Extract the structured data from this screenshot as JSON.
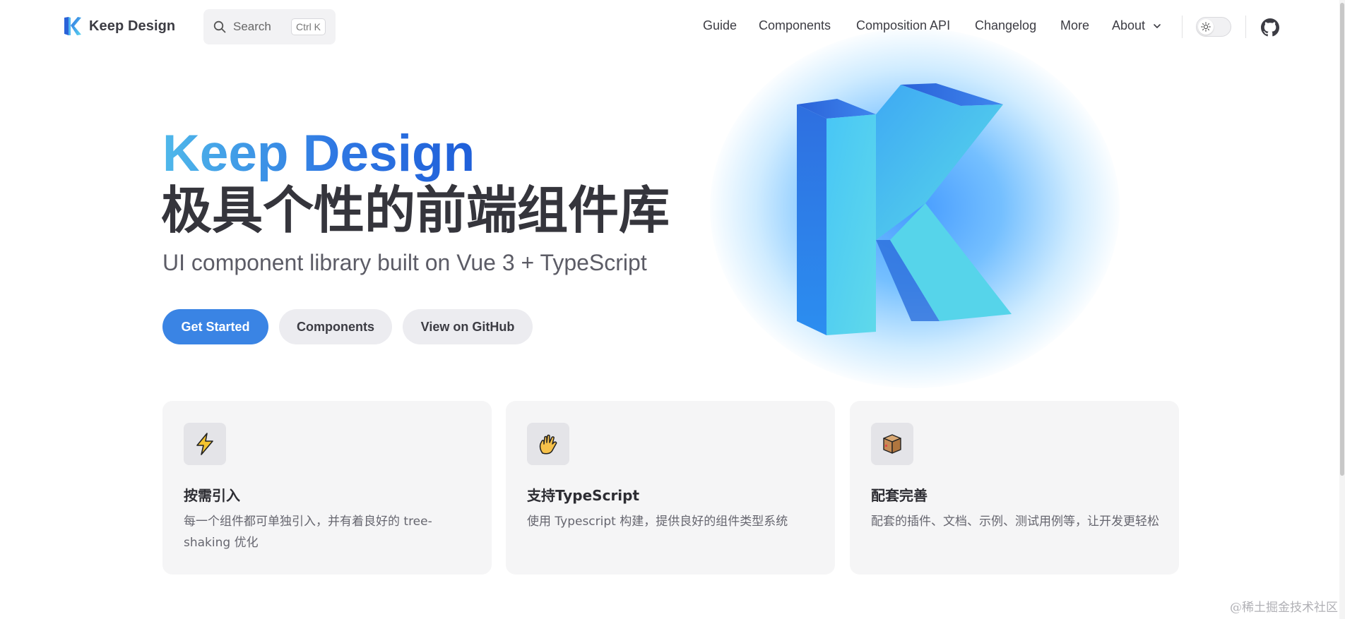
{
  "nav": {
    "brand": "Keep Design",
    "search": {
      "label": "Search",
      "shortcut": "Ctrl K"
    },
    "menu": [
      {
        "label": "Guide"
      },
      {
        "label": "Components"
      },
      {
        "label": "Composition API"
      },
      {
        "label": "Changelog"
      },
      {
        "label": "More"
      },
      {
        "label": "About"
      }
    ]
  },
  "hero": {
    "title": "Keep Design",
    "tagline": "极具个性的前端组件库",
    "subtitle": "UI component library built on Vue 3 + TypeScript",
    "buttons": {
      "primary": "Get Started",
      "components": "Components",
      "github": "View on GitHub"
    }
  },
  "features": [
    {
      "icon": "lightning-icon",
      "title": "按需引入",
      "desc": "每一个组件都可单独引入，并有着良好的 tree-shaking 优化"
    },
    {
      "icon": "vulcan-salute-icon",
      "title": "支持TypeScript",
      "desc": "使用 Typescript 构建，提供良好的组件类型系统"
    },
    {
      "icon": "package-icon",
      "title": "配套完善",
      "desc": "配套的插件、文档、示例、测试用例等，让开发更轻松"
    }
  ],
  "watermark": "@稀土掘金技术社区",
  "colors": {
    "primary": "#3a84e4",
    "title_gradient_start": "#4fb8ea",
    "title_gradient_end": "#1f5fd9",
    "card_bg": "#f5f5f6"
  }
}
